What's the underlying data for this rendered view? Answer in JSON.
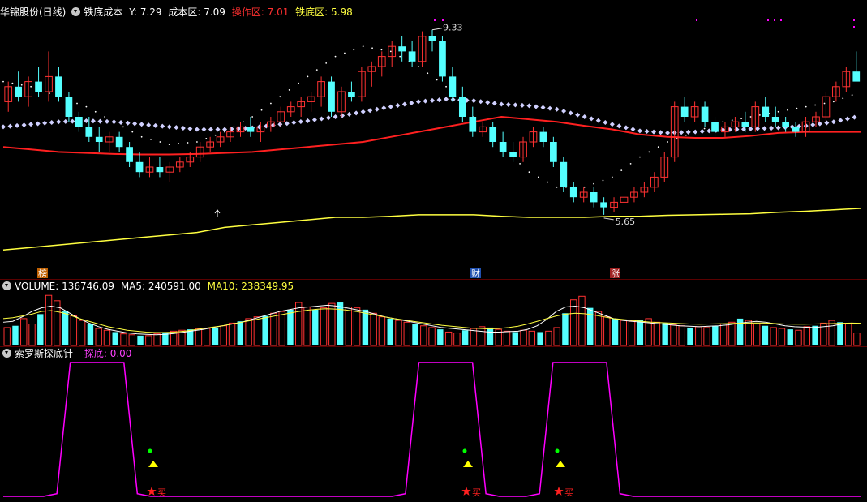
{
  "header_main": {
    "stock_name": "华锦股份(日线)",
    "indicator_name": "铁底成本",
    "y_label": "Y: 7.29",
    "cost_label": "成本区: 7.09",
    "op_label": "操作区: 7.01",
    "iron_label": "铁底区: 5.98"
  },
  "header_volume": {
    "title": "VOLUME: 136746.09",
    "ma5": "MA5: 240591.00",
    "ma10": "MA10: 238349.95"
  },
  "header_indicator": {
    "title": "索罗斯探底针",
    "label": "探底: 0.00"
  },
  "colors": {
    "up": "#ff3232",
    "down": "#54ffff",
    "ma_red": "#ff2020",
    "ma_yellow": "#ffff40",
    "diamond": "#d0d0ff",
    "dots": "#ffffff",
    "magenta": "#ff00ff",
    "buy_green": "#00ff00",
    "buy_yellow": "#ffff00",
    "star_red": "#ff2020"
  },
  "chart_data": [
    {
      "type": "candlestick",
      "title": "华锦股份(日线)",
      "annotations": [
        {
          "text": "9.33",
          "kind": "high"
        },
        {
          "text": "5.65",
          "kind": "low"
        }
      ],
      "event_tags": [
        "榜",
        "财",
        "涨"
      ],
      "candles": [
        [
          7.9,
          8.3,
          7.7,
          8.2
        ],
        [
          8.2,
          8.5,
          7.9,
          8.0
        ],
        [
          8.0,
          8.4,
          7.8,
          8.3
        ],
        [
          8.3,
          8.6,
          8.0,
          8.1
        ],
        [
          8.1,
          8.9,
          7.9,
          8.4
        ],
        [
          8.4,
          8.6,
          7.9,
          8.0
        ],
        [
          8.0,
          8.1,
          7.5,
          7.6
        ],
        [
          7.6,
          7.7,
          7.3,
          7.4
        ],
        [
          7.4,
          7.6,
          7.1,
          7.2
        ],
        [
          7.2,
          7.4,
          6.9,
          7.1
        ],
        [
          7.1,
          7.3,
          6.9,
          7.2
        ],
        [
          7.2,
          7.3,
          6.9,
          7.0
        ],
        [
          7.0,
          7.1,
          6.6,
          6.7
        ],
        [
          6.7,
          6.9,
          6.4,
          6.5
        ],
        [
          6.5,
          6.8,
          6.4,
          6.6
        ],
        [
          6.6,
          6.8,
          6.4,
          6.5
        ],
        [
          6.5,
          6.7,
          6.3,
          6.6
        ],
        [
          6.6,
          6.8,
          6.5,
          6.7
        ],
        [
          6.7,
          6.9,
          6.6,
          6.8
        ],
        [
          6.8,
          7.1,
          6.7,
          7.0
        ],
        [
          7.0,
          7.2,
          6.9,
          7.1
        ],
        [
          7.1,
          7.3,
          7.0,
          7.2
        ],
        [
          7.2,
          7.4,
          7.1,
          7.3
        ],
        [
          7.3,
          7.5,
          7.2,
          7.4
        ],
        [
          7.4,
          7.6,
          7.2,
          7.3
        ],
        [
          7.3,
          7.5,
          7.1,
          7.4
        ],
        [
          7.4,
          7.6,
          7.3,
          7.5
        ],
        [
          7.5,
          7.8,
          7.4,
          7.7
        ],
        [
          7.7,
          7.9,
          7.6,
          7.8
        ],
        [
          7.8,
          8.0,
          7.6,
          7.9
        ],
        [
          7.9,
          8.1,
          7.7,
          8.0
        ],
        [
          8.0,
          8.4,
          7.8,
          8.3
        ],
        [
          8.3,
          8.4,
          7.6,
          7.7
        ],
        [
          7.7,
          8.2,
          7.6,
          8.1
        ],
        [
          8.1,
          8.3,
          7.9,
          8.0
        ],
        [
          8.0,
          8.6,
          7.9,
          8.5
        ],
        [
          8.5,
          8.7,
          8.2,
          8.6
        ],
        [
          8.6,
          8.9,
          8.4,
          8.8
        ],
        [
          8.8,
          9.1,
          8.6,
          9.0
        ],
        [
          9.0,
          9.2,
          8.7,
          8.9
        ],
        [
          8.9,
          9.1,
          8.6,
          8.7
        ],
        [
          8.7,
          9.3,
          8.6,
          9.2
        ],
        [
          9.2,
          9.33,
          8.9,
          9.1
        ],
        [
          9.1,
          9.2,
          8.3,
          8.4
        ],
        [
          8.4,
          8.6,
          7.9,
          8.0
        ],
        [
          8.0,
          8.2,
          7.5,
          7.6
        ],
        [
          7.6,
          7.8,
          7.2,
          7.3
        ],
        [
          7.3,
          7.5,
          7.2,
          7.4
        ],
        [
          7.4,
          7.5,
          7.0,
          7.1
        ],
        [
          7.1,
          7.3,
          6.8,
          6.9
        ],
        [
          6.9,
          7.1,
          6.7,
          6.8
        ],
        [
          6.8,
          7.2,
          6.7,
          7.1
        ],
        [
          7.1,
          7.4,
          7.0,
          7.3
        ],
        [
          7.3,
          7.4,
          7.0,
          7.1
        ],
        [
          7.1,
          7.2,
          6.6,
          6.7
        ],
        [
          6.7,
          6.8,
          6.1,
          6.2
        ],
        [
          6.2,
          6.3,
          5.9,
          6.0
        ],
        [
          6.0,
          6.2,
          5.9,
          6.1
        ],
        [
          6.1,
          6.2,
          5.8,
          5.9
        ],
        [
          5.9,
          6.0,
          5.65,
          5.8
        ],
        [
          5.8,
          6.0,
          5.7,
          5.9
        ],
        [
          5.9,
          6.1,
          5.8,
          6.0
        ],
        [
          6.0,
          6.2,
          5.9,
          6.1
        ],
        [
          6.1,
          6.3,
          6.0,
          6.2
        ],
        [
          6.2,
          6.5,
          6.1,
          6.4
        ],
        [
          6.4,
          6.9,
          6.3,
          6.8
        ],
        [
          6.8,
          7.9,
          6.7,
          7.8
        ],
        [
          7.8,
          8.0,
          7.5,
          7.6
        ],
        [
          7.6,
          7.9,
          7.5,
          7.8
        ],
        [
          7.8,
          7.9,
          7.4,
          7.5
        ],
        [
          7.5,
          7.6,
          7.2,
          7.3
        ],
        [
          7.3,
          7.5,
          7.2,
          7.4
        ],
        [
          7.4,
          7.6,
          7.3,
          7.5
        ],
        [
          7.5,
          7.7,
          7.3,
          7.4
        ],
        [
          7.4,
          7.9,
          7.3,
          7.8
        ],
        [
          7.8,
          8.0,
          7.5,
          7.6
        ],
        [
          7.6,
          7.8,
          7.4,
          7.5
        ],
        [
          7.5,
          7.6,
          7.3,
          7.4
        ],
        [
          7.4,
          7.5,
          7.2,
          7.3
        ],
        [
          7.3,
          7.6,
          7.2,
          7.5
        ],
        [
          7.5,
          7.7,
          7.4,
          7.6
        ],
        [
          7.6,
          8.1,
          7.5,
          8.0
        ],
        [
          8.0,
          8.3,
          7.9,
          8.2
        ],
        [
          8.2,
          8.6,
          8.1,
          8.5
        ],
        [
          8.5,
          8.9,
          8.4,
          8.3
        ]
      ],
      "ma_red": [
        7.0,
        6.95,
        6.9,
        6.88,
        6.86,
        6.85,
        6.85,
        6.86,
        6.88,
        6.9,
        6.95,
        7.0,
        7.05,
        7.1,
        7.2,
        7.3,
        7.4,
        7.5,
        7.6,
        7.55,
        7.5,
        7.42,
        7.35,
        7.25,
        7.2,
        7.18,
        7.18,
        7.22,
        7.28,
        7.3,
        7.3,
        7.3
      ],
      "ma_yellow": [
        4.95,
        5.0,
        5.05,
        5.1,
        5.15,
        5.2,
        5.25,
        5.3,
        5.4,
        5.45,
        5.5,
        5.55,
        5.6,
        5.6,
        5.62,
        5.65,
        5.65,
        5.65,
        5.62,
        5.6,
        5.6,
        5.6,
        5.62,
        5.62,
        5.64,
        5.65,
        5.66,
        5.67,
        5.7,
        5.72,
        5.75,
        5.78
      ],
      "diamond_line": [
        7.4,
        7.45,
        7.5,
        7.52,
        7.5,
        7.45,
        7.4,
        7.35,
        7.35,
        7.38,
        7.45,
        7.52,
        7.6,
        7.7,
        7.8,
        7.9,
        7.95,
        7.92,
        7.85,
        7.82,
        7.75,
        7.6,
        7.45,
        7.32,
        7.28,
        7.3,
        7.34,
        7.36,
        7.38,
        7.42,
        7.5,
        7.62
      ],
      "dotted_line": [
        8.3,
        8.2,
        8.0,
        7.8,
        7.5,
        7.2,
        7.05,
        7.1,
        7.3,
        7.6,
        8.0,
        8.4,
        8.8,
        9.0,
        8.9,
        8.6,
        8.2,
        7.6,
        7.0,
        6.5,
        6.2,
        6.2,
        6.4,
        6.8,
        7.1,
        7.3,
        7.5,
        7.6,
        7.7,
        7.8,
        7.9,
        8.1
      ],
      "ylim": [
        4.6,
        9.6
      ]
    },
    {
      "type": "bar",
      "title": "VOLUME",
      "series": [
        {
          "name": "VOLUME",
          "values": [
            200,
            220,
            300,
            240,
            350,
            560,
            500,
            380,
            330,
            280,
            240,
            190,
            170,
            150,
            130,
            120,
            110,
            110,
            130,
            150,
            160,
            170,
            180,
            190,
            190,
            200,
            220,
            250,
            270,
            300,
            320,
            330,
            360,
            380,
            400,
            480,
            430,
            400,
            420,
            470,
            480,
            430,
            420,
            400,
            360,
            320,
            300,
            280,
            260,
            240,
            220,
            200,
            180,
            150,
            140,
            170,
            190,
            210,
            200,
            180,
            160,
            150,
            170,
            160,
            150,
            160,
            200,
            360,
            510,
            550,
            420,
            380,
            320,
            300,
            280,
            270,
            290,
            300,
            260,
            250,
            230,
            220,
            200,
            210,
            200,
            220,
            240,
            260,
            300,
            280,
            240,
            220,
            200,
            190,
            180,
            170,
            210,
            220,
            250,
            280,
            260,
            240,
            140
          ]
        },
        {
          "name": "MA5",
          "values": [
            260,
            270,
            320,
            380,
            420,
            440,
            420,
            360,
            300,
            250,
            210,
            180,
            160,
            140,
            130,
            125,
            120,
            125,
            135,
            150,
            165,
            180,
            200,
            220,
            240,
            260,
            290,
            320,
            350,
            380,
            400,
            420,
            430,
            440,
            450,
            440,
            420,
            400,
            380,
            350,
            320,
            300,
            280,
            260,
            240,
            220,
            200,
            190,
            180,
            170,
            160,
            150,
            150,
            155,
            160,
            180,
            220,
            290,
            380,
            430,
            440,
            420,
            380,
            340,
            300,
            280,
            270,
            260,
            250,
            240,
            230,
            220,
            215,
            210,
            215,
            220,
            230,
            245,
            260,
            270,
            260,
            240,
            220,
            210,
            205,
            200,
            210,
            220,
            240,
            250,
            240
          ]
        },
        {
          "name": "MA10",
          "values": [
            300,
            310,
            330,
            350,
            380,
            390,
            370,
            340,
            300,
            270,
            240,
            210,
            190,
            170,
            160,
            150,
            145,
            145,
            150,
            160,
            175,
            190,
            205,
            220,
            240,
            260,
            280,
            300,
            320,
            340,
            360,
            380,
            395,
            405,
            410,
            405,
            395,
            380,
            360,
            340,
            320,
            300,
            285,
            270,
            255,
            240,
            225,
            215,
            205,
            195,
            190,
            185,
            190,
            200,
            215,
            240,
            270,
            300,
            330,
            350,
            360,
            355,
            340,
            320,
            300,
            290,
            280,
            270,
            260,
            255,
            250,
            245,
            240,
            238,
            240,
            242,
            245,
            248,
            250,
            252,
            250,
            245,
            240,
            238,
            238,
            240,
            242,
            245,
            248,
            250,
            248
          ]
        }
      ]
    },
    {
      "type": "line",
      "title": "索罗斯探底针",
      "series": [
        {
          "name": "探底",
          "values": [
            0,
            0,
            0,
            0,
            0.02,
            1,
            1,
            1,
            1,
            1,
            0.02,
            0,
            0,
            0,
            0,
            0,
            0,
            0,
            0,
            0,
            0,
            0,
            0,
            0,
            0,
            0,
            0,
            0,
            0,
            0,
            0.02,
            1,
            1,
            1,
            1,
            1,
            0.02,
            0,
            0,
            0,
            0.02,
            1,
            1,
            1,
            1,
            1,
            0.02,
            0,
            0,
            0,
            0,
            0,
            0,
            0,
            0,
            0,
            0,
            0,
            0,
            0,
            0,
            0,
            0,
            0,
            0
          ]
        }
      ],
      "buy_label": "买"
    }
  ]
}
